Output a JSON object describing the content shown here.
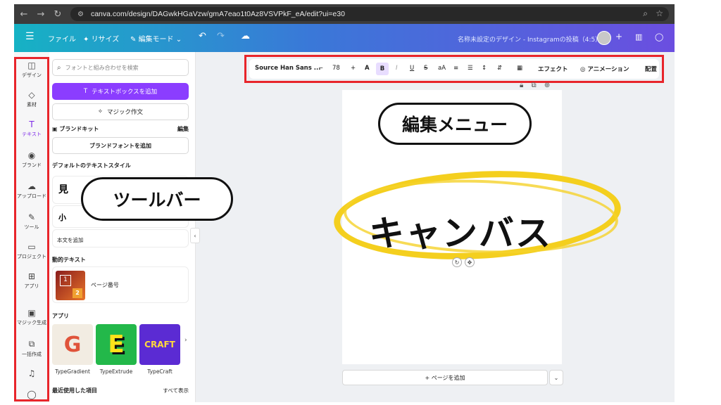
{
  "browser": {
    "url": "canva.com/design/DAGwkHGaVzw/gmA7eao1t0Az8VSVPkF_eA/edit?ui=e30"
  },
  "header": {
    "file": "ファイル",
    "resize": "リサイズ",
    "edit_mode": "編集モード",
    "title": "名称未設定のデザイン - Instagramの投稿（4:5）"
  },
  "rail": {
    "items": [
      {
        "label": "デザイン"
      },
      {
        "label": "素材"
      },
      {
        "label": "テキスト"
      },
      {
        "label": "ブランド"
      },
      {
        "label": "アップロード"
      },
      {
        "label": "ツール"
      },
      {
        "label": "プロジェクト"
      },
      {
        "label": "アプリ"
      },
      {
        "label": "マジック生成"
      },
      {
        "label": "一括作成"
      }
    ]
  },
  "panel": {
    "search_placeholder": "フォントと組み合わせを検索",
    "add_textbox": "テキストボックスを追加",
    "magic_write": "マジック作文",
    "brand_kit": "ブランドキット",
    "brand_edit": "編集",
    "add_brand_font": "ブランドフォントを追加",
    "default_styles": "デフォルトのテキストスタイル",
    "heading_style": "見",
    "subheading_style": "小",
    "body_style": "本文を追加",
    "dynamic_text": "動的テキスト",
    "page_number": "ページ番号",
    "dyn_badge_1": "1",
    "dyn_badge_2": "2",
    "apps_title": "アプリ",
    "apps": [
      {
        "name": "TypeGradient",
        "glyph": "G"
      },
      {
        "name": "TypeExtrude",
        "glyph": "E"
      },
      {
        "name": "TypeCraft",
        "glyph": "CRAFT"
      }
    ],
    "recent": "最近使用した項目",
    "show_all": "すべて表示"
  },
  "toolbar": {
    "font": "Source Han Sans ...",
    "minus": "−",
    "size": "78",
    "plus": "+",
    "color": "A",
    "bold": "B",
    "italic": "I",
    "underline": "U",
    "strike": "S",
    "case": "aA",
    "effect": "エフェクト",
    "animation": "アニメーション",
    "position": "配置"
  },
  "canvas": {
    "main_text": "キャンバス",
    "add_page": "+ ページを追加"
  },
  "callouts": {
    "toolbar_label": "ツールバー",
    "edit_menu_label": "編集メニュー"
  },
  "colors": {
    "accent": "#8b3dff",
    "highlight_box": "#e8252b",
    "marker_ring": "#f3cc12"
  }
}
